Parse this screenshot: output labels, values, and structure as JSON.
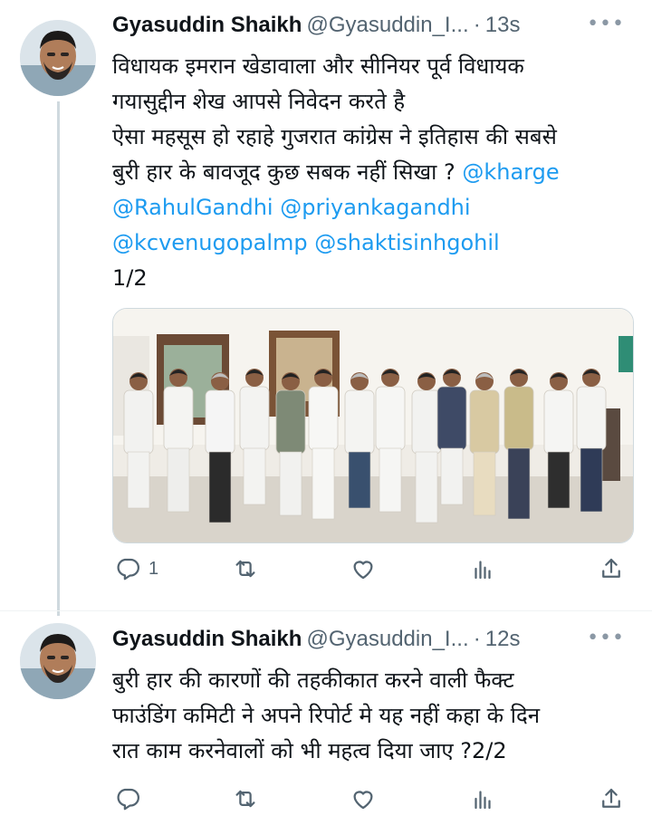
{
  "tweets": [
    {
      "name": "Gyasuddin Shaikh",
      "handle": "@Gyasuddin_I...",
      "dot": "·",
      "time": "13s",
      "lines": [
        "विधायक इमरान खेडावाला और सीनियर पूर्व विधायक",
        "गयासुद्दीन शेख आपसे निवेदन करते है",
        "ऐसा महसूस हो रहाहे गुजरात कांग्रेस ने इतिहास की सबसे",
        "बुरी हार के बावजूद कुछ सबक नहीं सिखा ?"
      ],
      "mentions": [
        "@kharge",
        "@RahulGandhi",
        "@priyankagandhi",
        "@kcvenugopalmp",
        "@shaktisinhgohil"
      ],
      "thread_marker": "1/2",
      "reply_count": "1",
      "icons": [
        "more-icon",
        "reply-icon",
        "retweet-icon",
        "like-icon",
        "views-icon",
        "share-icon"
      ]
    },
    {
      "name": "Gyasuddin Shaikh",
      "handle": "@Gyasuddin_I...",
      "dot": "·",
      "time": "12s",
      "lines": [
        "बुरी हार की कारणों की तहकीकात करने वाली फैक्ट",
        "फाउंडिंग कमिटी ने अपने रिपोर्ट मे यह नहीं कहा के दिन",
        "रात काम करनेवालों को भी महत्व दिया जाए ?2/2"
      ],
      "icons": [
        "more-icon",
        "reply-icon",
        "retweet-icon",
        "like-icon",
        "views-icon",
        "share-icon"
      ]
    }
  ],
  "colors": {
    "text": "#0f1419",
    "secondary": "#536471",
    "link": "#1d9bf0",
    "line": "#cfd9de"
  }
}
